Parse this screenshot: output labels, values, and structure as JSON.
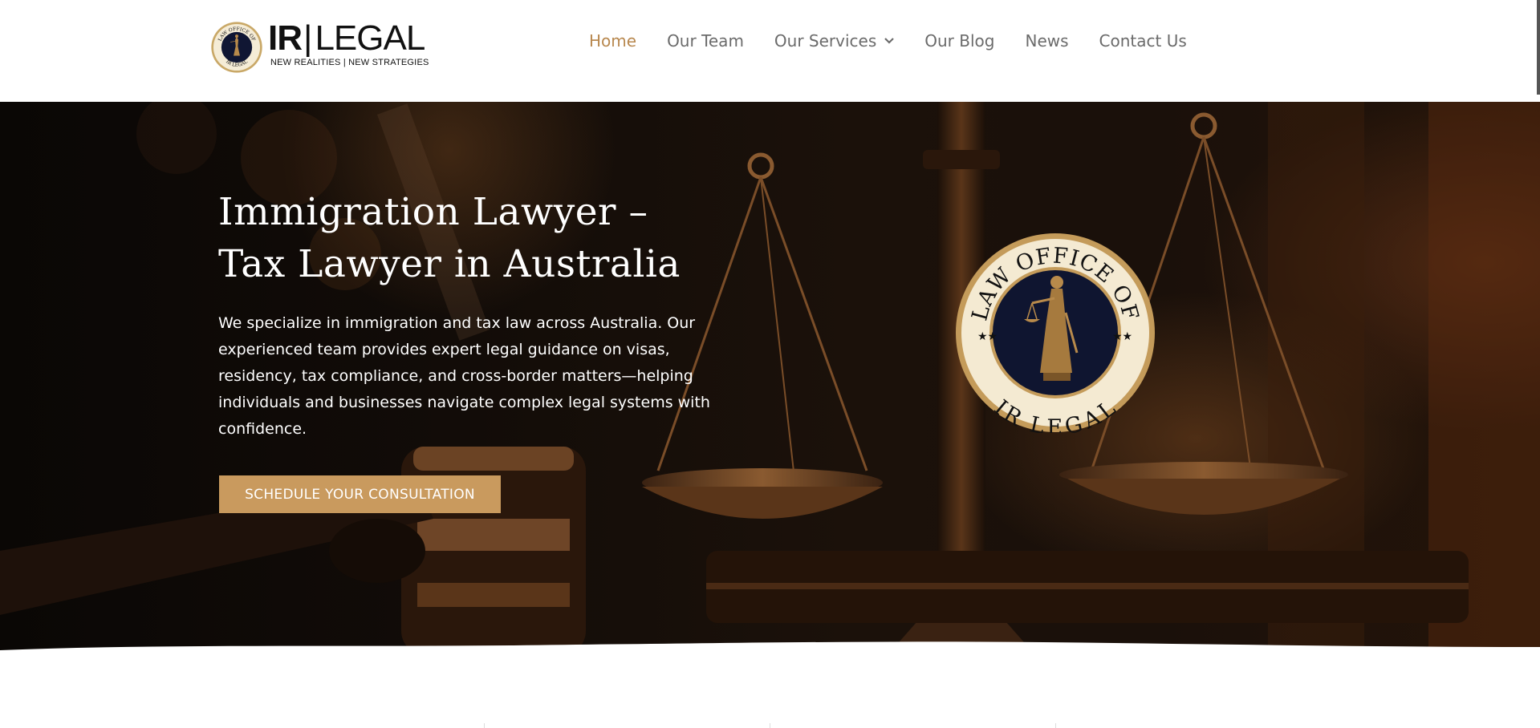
{
  "header": {
    "logo": {
      "ir": "IR",
      "separator": "|",
      "legal": "LEGAL",
      "tagline": "NEW REALITIES | NEW STRATEGIES",
      "seal_text_top": "LAW OFFICE OF",
      "seal_text_bottom": "IR LEGAL"
    },
    "nav": [
      {
        "label": "Home",
        "active": true
      },
      {
        "label": "Our Team",
        "active": false
      },
      {
        "label": "Our Services",
        "active": false,
        "dropdown": true
      },
      {
        "label": "Our Blog",
        "active": false
      },
      {
        "label": "News",
        "active": false
      },
      {
        "label": "Contact Us",
        "active": false
      }
    ]
  },
  "hero": {
    "title_line1": "Immigration Lawyer –",
    "title_line2": "Tax Lawyer in Australia",
    "description": "We specialize in immigration and tax law across  Australia. Our experienced team provides expert legal guidance on visas, residency, tax compliance, and cross-border matters—helping individuals and businesses navigate complex legal systems with confidence.",
    "cta_label": "SCHEDULE YOUR CONSULTATION",
    "seal": {
      "top_text": "LAW OFFICE OF",
      "bottom_text": "IR LEGAL"
    }
  },
  "colors": {
    "accent": "#c99a5e",
    "nav_active": "#b8884f",
    "nav_text": "#6b6b6b",
    "seal_navy": "#0f1530",
    "seal_cream": "#f4ead2"
  },
  "icons": {
    "dropdown": "chevron-down-icon",
    "seal": "lady-justice-seal-icon",
    "background": "scales-and-gavel-photo"
  }
}
